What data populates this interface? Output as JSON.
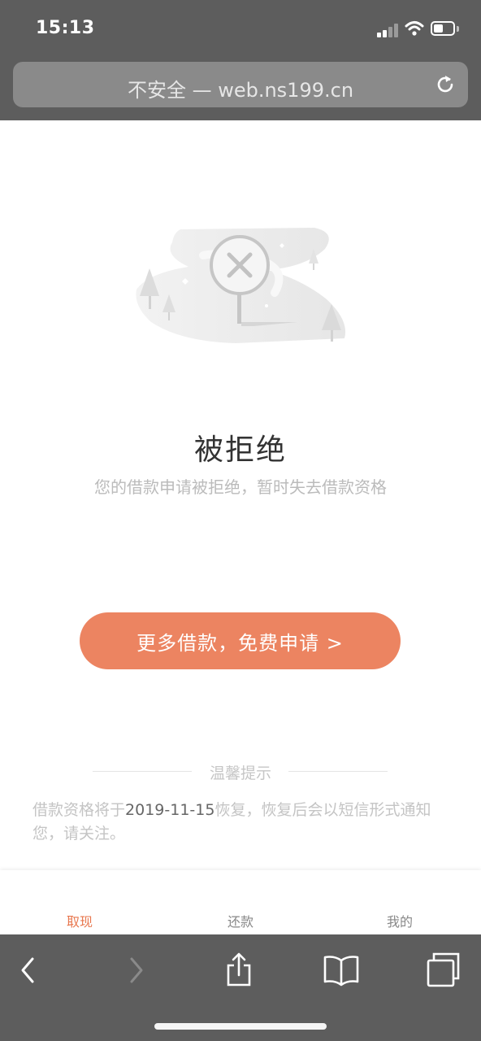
{
  "status_bar": {
    "time": "15:13"
  },
  "browser": {
    "url_text": "不安全 — web.ns199.cn"
  },
  "result": {
    "title": "被拒绝",
    "description": "您的借款申请被拒绝，暂时失去借款资格"
  },
  "cta": {
    "label": "更多借款，免费申请 >"
  },
  "tips": {
    "title": "温馨提示",
    "text_before": "借款资格将于",
    "date": "2019-11-15",
    "text_after": "恢复，恢复后会以短信形式通知您，请关注。"
  },
  "tabs": [
    {
      "label": "取现",
      "active": true
    },
    {
      "label": "还款",
      "active": false
    },
    {
      "label": "我的",
      "active": false
    }
  ],
  "colors": {
    "accent": "#ec8461",
    "active_tab": "#e8774e",
    "chrome": "#5d5d5d"
  },
  "icons": {
    "reload": "reload-icon",
    "back": "chevron-left-icon",
    "forward": "chevron-right-icon",
    "share": "share-icon",
    "bookmarks": "book-icon",
    "tabs": "tabs-icon"
  }
}
